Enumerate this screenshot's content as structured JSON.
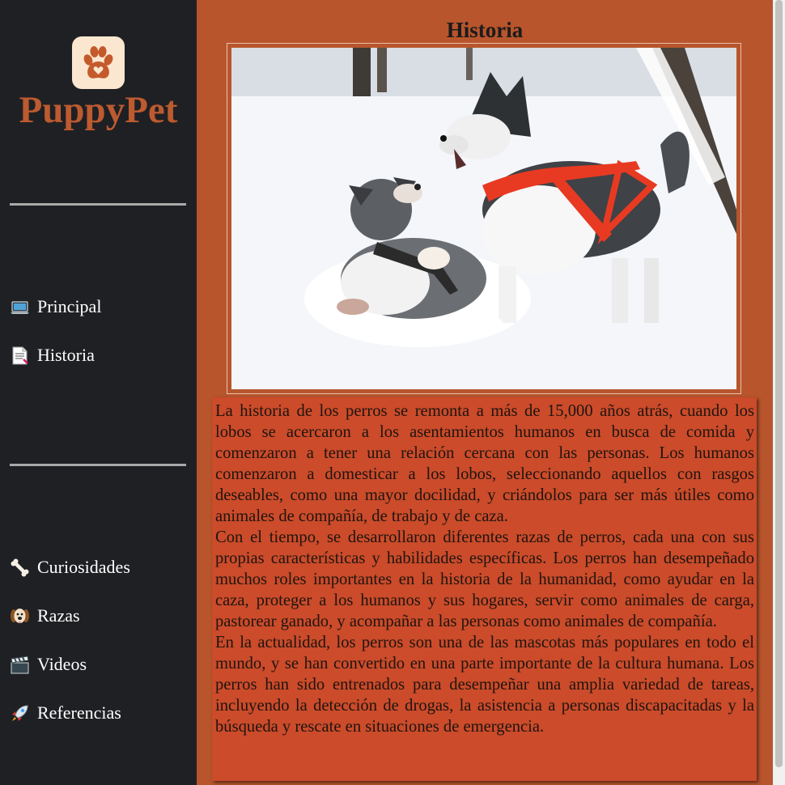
{
  "sidebar": {
    "brand": "PuppyPet",
    "logo_icon": "paw-heart-icon",
    "nav_top": [
      {
        "label": "Principal",
        "icon": "laptop-icon"
      },
      {
        "label": "Historia",
        "icon": "document-icon"
      }
    ],
    "nav_bottom": [
      {
        "label": "Curiosidades",
        "icon": "bone-icon"
      },
      {
        "label": "Razas",
        "icon": "dog-face-icon"
      },
      {
        "label": "Videos",
        "icon": "clapper-board-icon"
      },
      {
        "label": "Referencias",
        "icon": "rocket-icon"
      }
    ]
  },
  "main": {
    "title": "Historia",
    "image": "two-huskies-playing-in-snow",
    "paragraphs": [
      "La historia de los perros se remonta a más de 15,000 años atrás, cuando los lobos se acercaron a los asentamientos humanos en busca de comida y comenzaron a tener una relación cercana con las personas. Los humanos comenzaron a domesticar a los lobos, seleccionando aquellos con rasgos deseables, como una mayor docilidad, y criándolos para ser más útiles como animales de compañía, de trabajo y de caza.",
      "Con el tiempo, se desarrollaron diferentes razas de perros, cada una con sus propias características y habilidades específicas. Los perros han desempeñado muchos roles importantes en la historia de la humanidad, como ayudar en la caza, proteger a los humanos y sus hogares, servir como animales de carga, pastorear ganado, y acompañar a las personas como animales de compañía.",
      "En la actualidad, los perros son una de las mascotas más populares en todo el mundo, y se han convertido en una parte importante de la cultura humana. Los perros han sido entrenados para desempeñar una amplia variedad de tareas, incluyendo la detección de drogas, la asistencia a personas discapacitadas y la búsqueda y rescate en situaciones de emergencia."
    ]
  },
  "colors": {
    "sidebar_bg": "#1f2023",
    "page_bg": "#b8552c",
    "brand": "#bc5a30",
    "textbox_bg": "#cb4b2a"
  }
}
